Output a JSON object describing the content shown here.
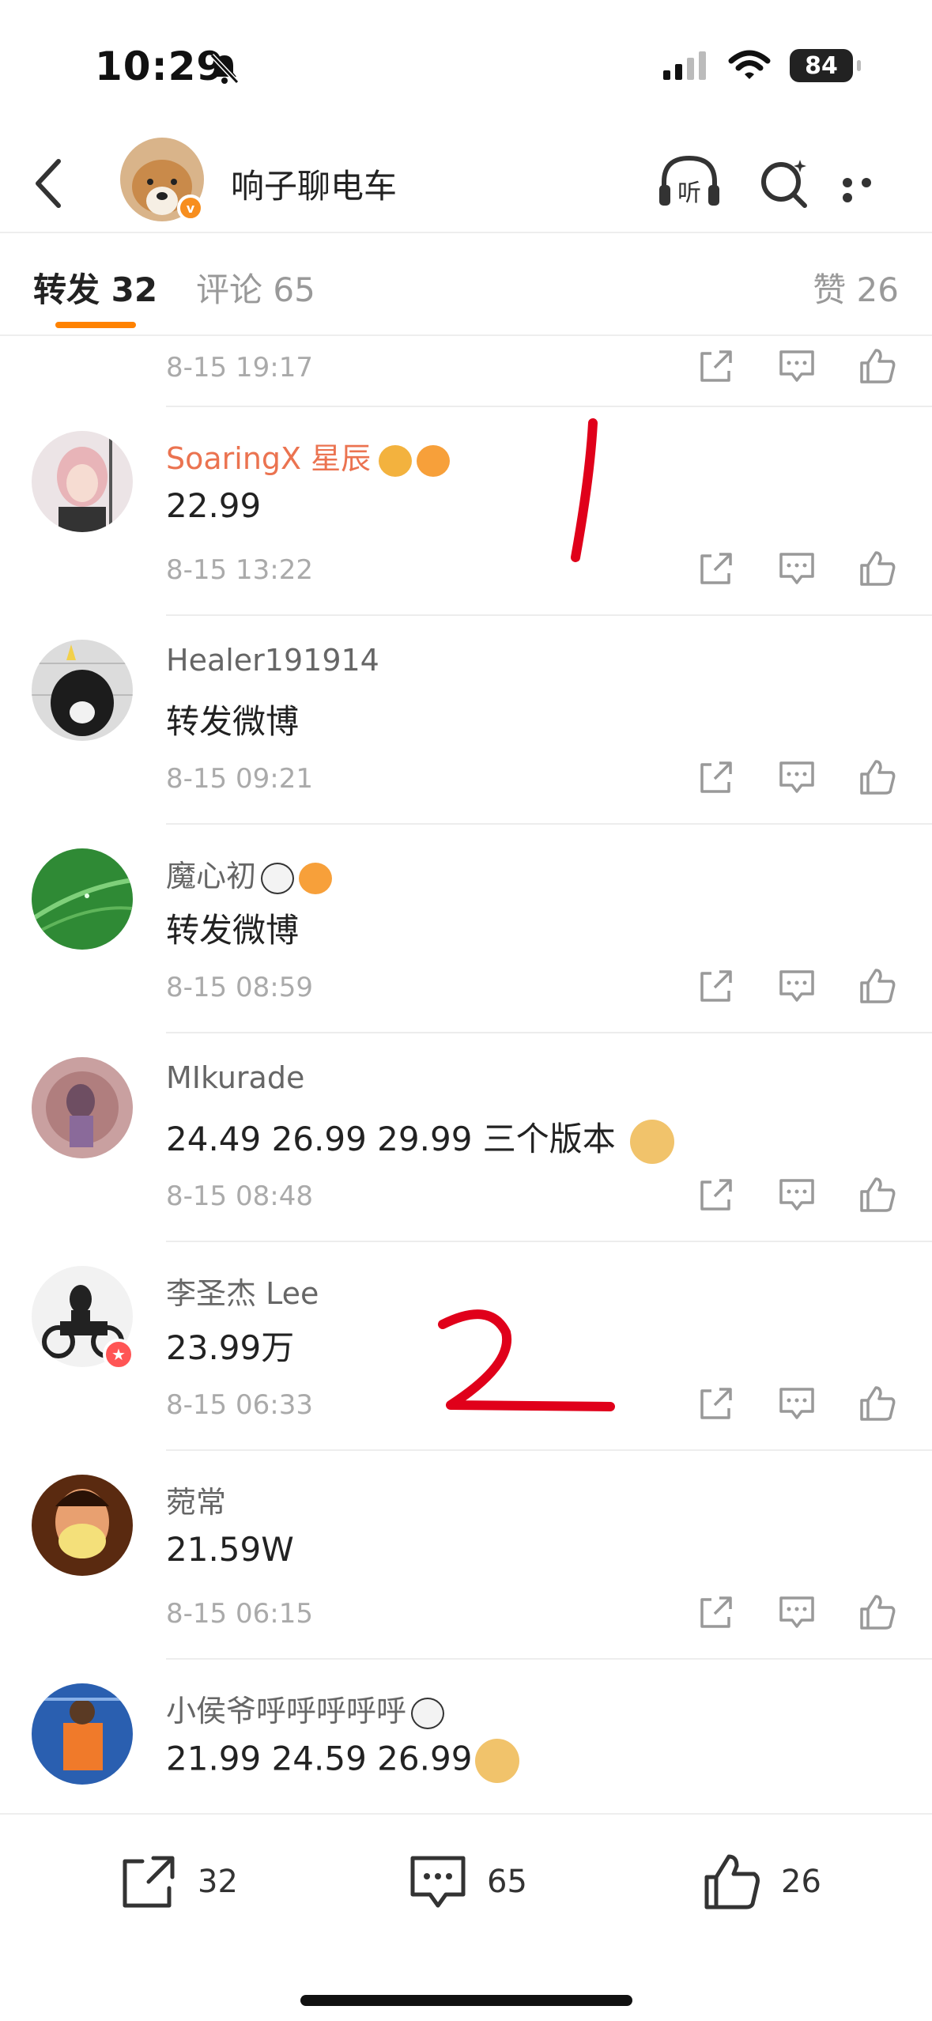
{
  "status_bar": {
    "time": "10:29",
    "battery": "84"
  },
  "header": {
    "username": "响子聊电车",
    "verified_badge": "v"
  },
  "tabs": {
    "repost": "转发 32",
    "comment": "评论 65",
    "likes": "赞 26"
  },
  "partial_row": {
    "time": "8-15 19:17"
  },
  "items": [
    {
      "name": "SoaringX 星辰",
      "content": "22.99",
      "time": "8-15 13:22"
    },
    {
      "name": "Healer191914",
      "content": "转发微博",
      "time": "8-15 09:21"
    },
    {
      "name": "魔心初",
      "content": "转发微博",
      "time": "8-15 08:59"
    },
    {
      "name": "MIkurade",
      "content": "24.49  26.99  29.99 三个版本",
      "time": "8-15 08:48"
    },
    {
      "name": "李圣杰 Lee",
      "content": "23.99万",
      "time": "8-15 06:33"
    },
    {
      "name": "菀常",
      "content": "21.59W",
      "time": "8-15 06:15"
    },
    {
      "name": "小侯爷呼呼呼呼呼",
      "content": "21.99 24.59 26.99",
      "time": ""
    }
  ],
  "bottom_bar": {
    "repost_count": "32",
    "comment_count": "65",
    "like_count": "26"
  },
  "colors": {
    "accent": "#ff8200",
    "vip_name": "#eb7350",
    "annotation": "#e0001a"
  }
}
